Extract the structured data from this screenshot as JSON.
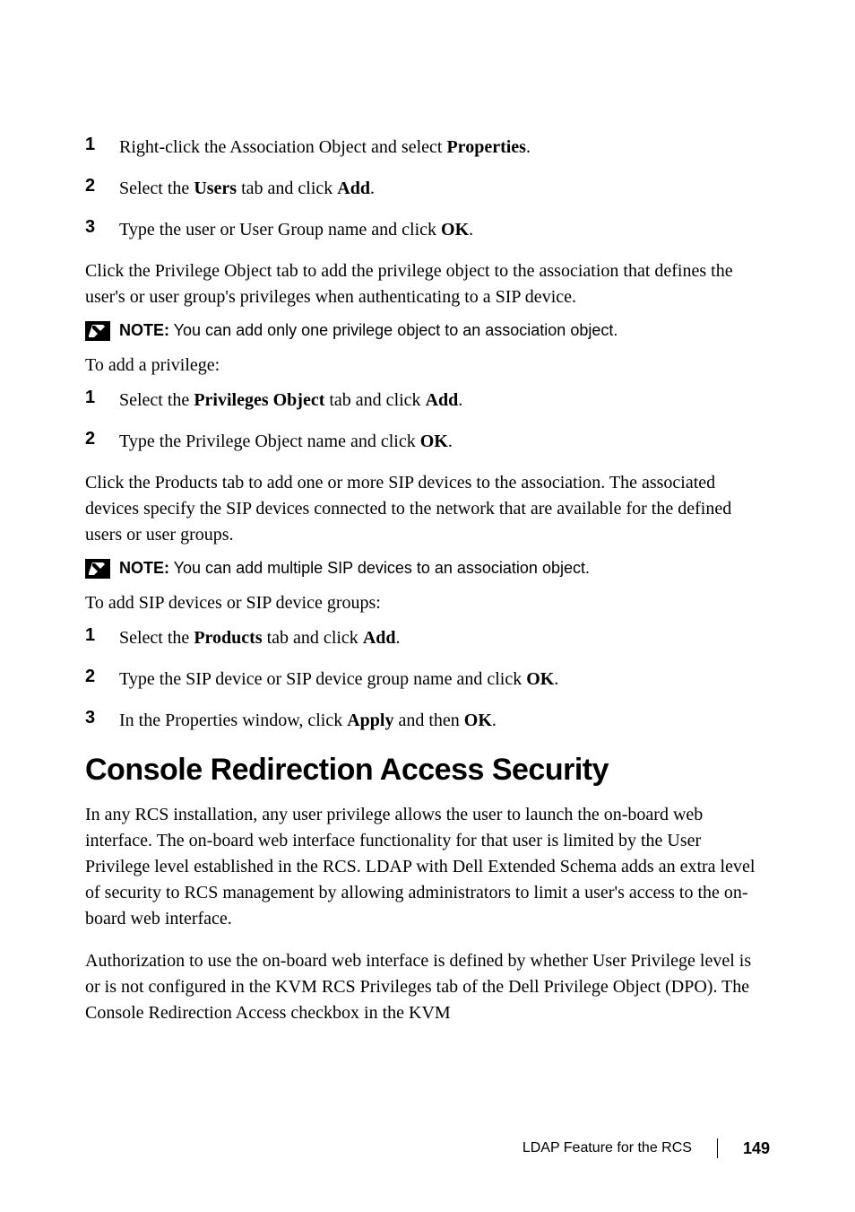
{
  "list1": [
    {
      "num": "1",
      "pre": "Right-click the Association Object and select ",
      "bold": "Properties",
      "post": "."
    },
    {
      "num": "2",
      "pre": "Select the ",
      "bold": "Users",
      "mid": " tab and click ",
      "bold2": "Add",
      "post": "."
    },
    {
      "num": "3",
      "pre": "Type the user or User Group name and click ",
      "bold": "OK",
      "post": "."
    }
  ],
  "para1": "Click the Privilege Object tab to add the privilege object to the association that defines the user's or user group's privileges when authenticating to a SIP device.",
  "note1": {
    "label": "NOTE:",
    "text": " You can add only one privilege object to an association object."
  },
  "para2": "To add a privilege:",
  "list2": [
    {
      "num": "1",
      "pre": "Select the ",
      "bold": "Privileges Object",
      "mid": " tab and click ",
      "bold2": "Add",
      "post": "."
    },
    {
      "num": "2",
      "pre": "Type the Privilege Object name and click ",
      "bold": "OK",
      "post": "."
    }
  ],
  "para3": "Click the Products tab to add one or more SIP devices to the association. The associated devices specify the SIP devices connected to the network that are available for the defined users or user groups.",
  "note2": {
    "label": "NOTE:",
    "text": " You can add multiple SIP devices to an association object."
  },
  "para4": "To add SIP devices or SIP device groups:",
  "list3": [
    {
      "num": "1",
      "pre": "Select the ",
      "bold": "Products",
      "mid": " tab and click ",
      "bold2": "Add",
      "post": "."
    },
    {
      "num": "2",
      "pre": "Type the SIP device or SIP device group name and click ",
      "bold": "OK",
      "post": "."
    },
    {
      "num": "3",
      "pre": "In the Properties window, click ",
      "bold": "Apply",
      "mid": " and then ",
      "bold2": "OK",
      "post": "."
    }
  ],
  "heading": "Console Redirection Access Security",
  "para5": "In any RCS installation, any user privilege allows the user to launch the on-board web interface. The on-board web interface functionality for that user is limited by the User Privilege level established in the RCS. LDAP with Dell Extended Schema adds an extra level of security to RCS management by allowing administrators to limit a user's access to the on-board web interface.",
  "para6": "Authorization to use the on-board web interface is defined by whether User Privilege level is or is not configured in the KVM RCS Privileges tab of the Dell Privilege Object (DPO). The Console Redirection Access checkbox in the KVM",
  "footer": {
    "text": "LDAP Feature for the RCS",
    "page": "149"
  }
}
